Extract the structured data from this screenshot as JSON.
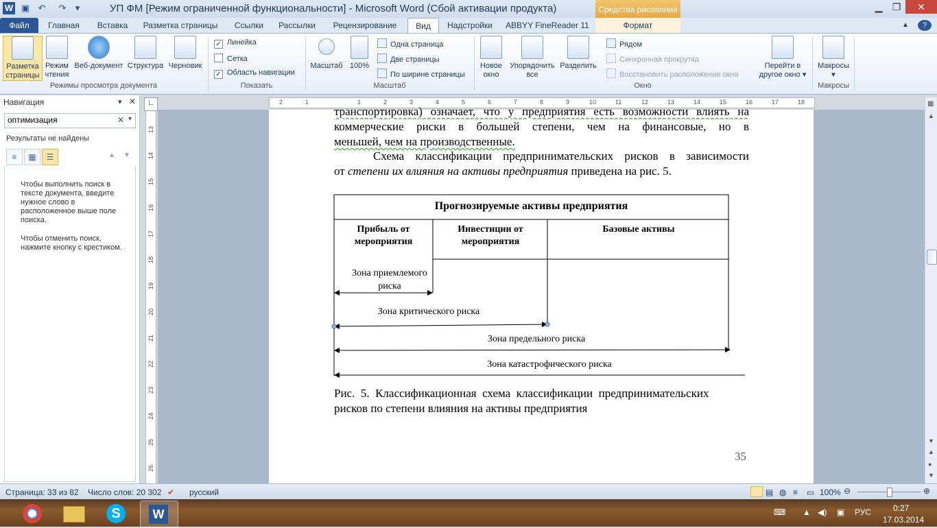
{
  "window": {
    "title": "УП ФМ [Режим ограниченной функциональности]  -  Microsoft Word (Сбой активации продукта)",
    "context_tab": "Средства рисования",
    "context_sub": "Формат"
  },
  "tabs": [
    "Файл",
    "Главная",
    "Вставка",
    "Разметка страницы",
    "Ссылки",
    "Рассылки",
    "Рецензирование",
    "Вид",
    "Надстройки",
    "ABBYY FineReader 11"
  ],
  "ribbon": {
    "views": {
      "print_layout": "Разметка страницы",
      "reading": "Режим чтения",
      "web": "Веб-документ",
      "outline": "Структура",
      "draft": "Черновик",
      "label": "Режимы просмотра документа"
    },
    "show": {
      "ruler": "Линейка",
      "gridlines": "Сетка",
      "nav_pane": "Область навигации",
      "label": "Показать"
    },
    "zoom": {
      "zoom": "Масштаб",
      "hundred": "100%",
      "one_page": "Одна страница",
      "two_pages": "Две страницы",
      "page_width": "По ширине страницы",
      "label": "Масштаб"
    },
    "window": {
      "new_window": "Новое окно",
      "arrange_all": "Упорядочить все",
      "split": "Разделить",
      "side_by_side": "Рядом",
      "sync_scroll": "Синхронная прокрутка",
      "reset_pos": "Восстановить расположение окна",
      "switch": "Перейти в другое окно",
      "label": "Окно"
    },
    "macros": {
      "macros": "Макросы",
      "label": "Макросы"
    }
  },
  "nav": {
    "title": "Навигация",
    "search_value": "оптимизация",
    "no_results": "Результаты не найдены",
    "help1": "Чтобы выполнить поиск в тексте документа, введите нужное слово в расположенное выше поле поиска.",
    "help2": "Чтобы отменить поиск, нажмите кнопку с крестиком."
  },
  "doc": {
    "line0": "транспортировка) означает, что у предприятия есть возможности влиять на",
    "line1": "коммерческие риски в большей степени, чем на финансовые, но в",
    "line2": "меньшей, чем на производственные.",
    "line3_a": "Схема классификации предпринимательских рисков в зависимости",
    "line4_a": "от ",
    "line4_i": "степени их влияния на активы предприятия",
    "line4_b": " приведена на рис. 5.",
    "diagram": {
      "header": "Прогнозируемые активы предприятия",
      "col1": "Прибыль от мероприятия",
      "col2": "Инвестиции от мероприятия",
      "col3": "Базовые активы",
      "zone1": "Зона приемлемого риска",
      "zone2": "Зона критического риска",
      "zone3": "Зона предельного риска",
      "zone4": "Зона катастрофического риска"
    },
    "caption1": "Рис.  5.  Классификационная  схема  классификации  предпринимательских",
    "caption2": "рисков по степени влияния на активы предприятия",
    "page_number": "35"
  },
  "status": {
    "page": "Страница: 33 из 82",
    "words": "Число слов: 20 302",
    "lang": "русский",
    "zoom": "100%"
  },
  "tray": {
    "lang": "РУС",
    "time": "0:27",
    "date": "17.03.2014"
  }
}
